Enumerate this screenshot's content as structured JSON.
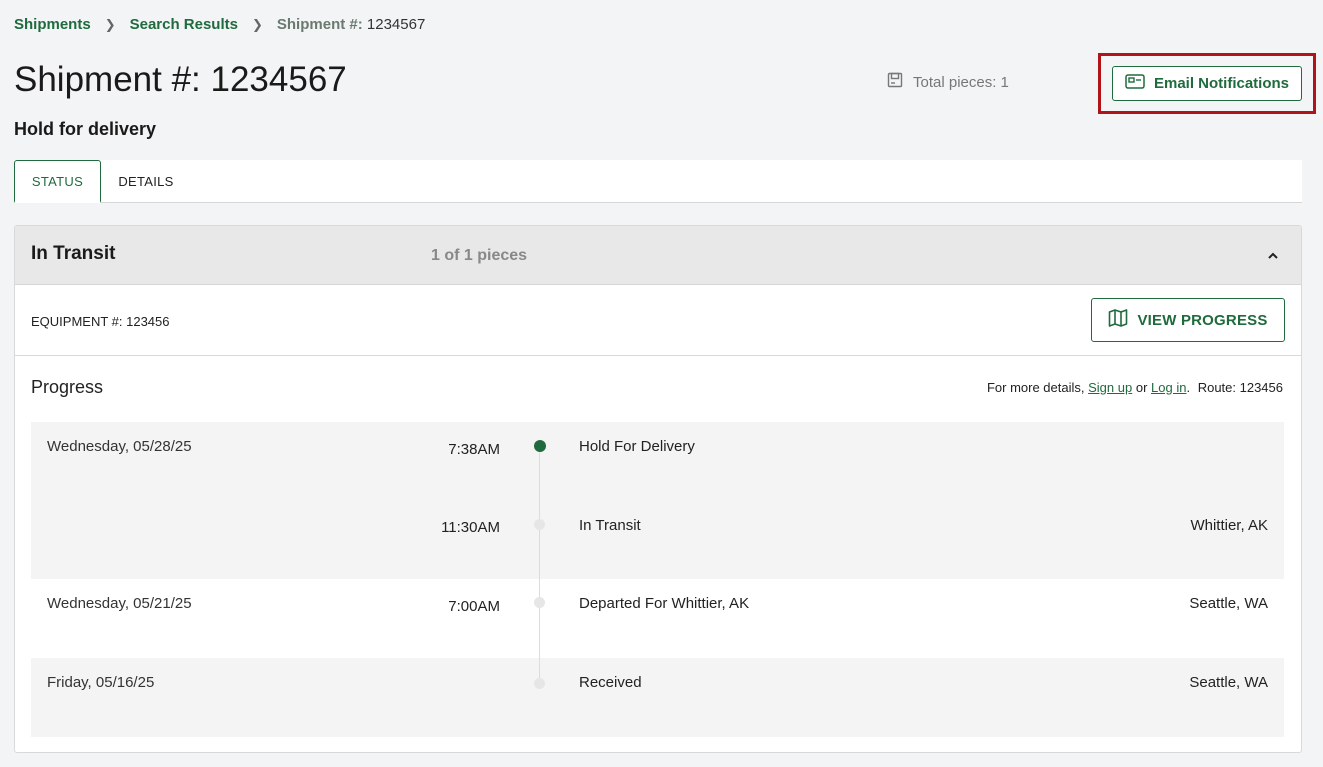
{
  "breadcrumb": {
    "items": [
      "Shipments",
      "Search Results"
    ],
    "current_label": "Shipment #:",
    "current_number": "1234567"
  },
  "header": {
    "title": "Shipment #: 1234567",
    "subtitle": "Hold for delivery",
    "total_pieces": "Total pieces: 1",
    "email_button": "Email Notifications"
  },
  "tabs": [
    {
      "label": "STATUS",
      "active": true
    },
    {
      "label": "DETAILS",
      "active": false
    }
  ],
  "card": {
    "title": "In Transit",
    "pieces": "1 of 1 pieces",
    "equipment": "EQUIPMENT #: 123456",
    "view_progress": "VIEW PROGRESS",
    "progress_title": "Progress",
    "info_prefix": "For more details,",
    "sign_up": "Sign up",
    "or_text": "or",
    "log_in": "Log in",
    "route": "Route: 123456"
  },
  "timeline": [
    {
      "date": "Wednesday, 05/28/25",
      "time": "7:38AM",
      "event": "Hold For Delivery",
      "location": "",
      "active": true
    },
    {
      "date": "",
      "time": "11:30AM",
      "event": "In Transit",
      "location": "Whittier, AK",
      "active": false
    },
    {
      "date": "Wednesday, 05/21/25",
      "time": "7:00AM",
      "event": "Departed For Whittier, AK",
      "location": "Seattle, WA",
      "active": false
    },
    {
      "date": "Friday, 05/16/25",
      "time": "",
      "event": "Received",
      "location": "Seattle, WA",
      "active": false
    }
  ],
  "colors": {
    "brand": "#1f6b3d",
    "highlight": "#b01318"
  }
}
